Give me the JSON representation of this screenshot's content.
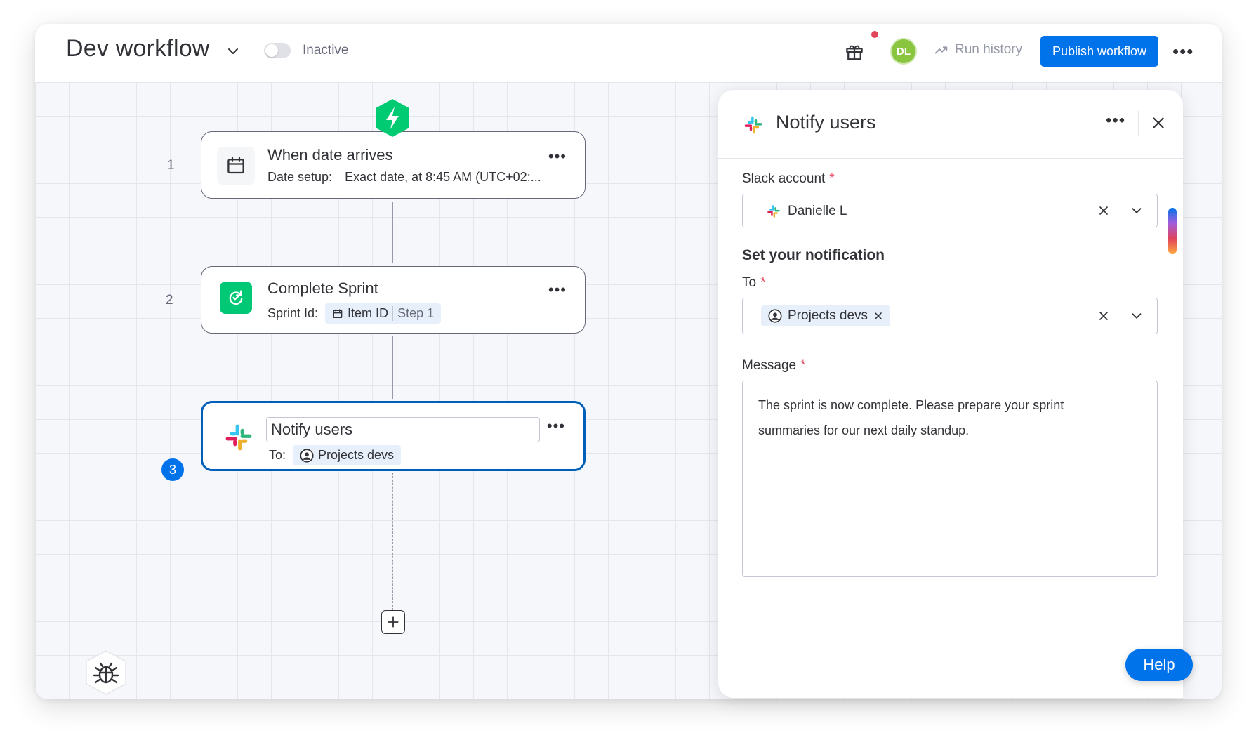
{
  "header": {
    "title": "Dev workflow",
    "status_label": "Inactive",
    "avatar_initials": "DL",
    "run_history_label": "Run history",
    "publish_label": "Publish workflow",
    "more_label": "•••"
  },
  "steps": [
    {
      "number": "1",
      "title": "When date arrives",
      "sub_label": "Date setup:",
      "sub_value": "Exact date, at 8:45 AM (UTC+02:...",
      "icon": "calendar-icon"
    },
    {
      "number": "2",
      "title": "Complete Sprint",
      "sub_label": "Sprint Id:",
      "chip_label": "Item ID",
      "chip_muted": "Step 1",
      "icon": "sprint-icon"
    },
    {
      "number": "3",
      "title": "Notify users",
      "sub_label": "To:",
      "chip_label": "Projects devs",
      "icon": "slack-icon"
    }
  ],
  "panel": {
    "title": "Notify users",
    "slack_account_label": "Slack account",
    "slack_account_value": "Danielle L",
    "section_title": "Set your notification",
    "to_label": "To",
    "to_tag": "Projects devs",
    "message_label": "Message",
    "message_value": "The sprint is now complete. Please prepare your sprint summaries for our next daily standup.",
    "required_mark": "*",
    "more_label": "•••"
  },
  "help_label": "Help",
  "colors": {
    "primary": "#0073ea",
    "trigger_green": "#00ca72",
    "sprint_green": "#00c875",
    "avatar_green": "#8ac53f",
    "required_red": "#e2445c"
  }
}
